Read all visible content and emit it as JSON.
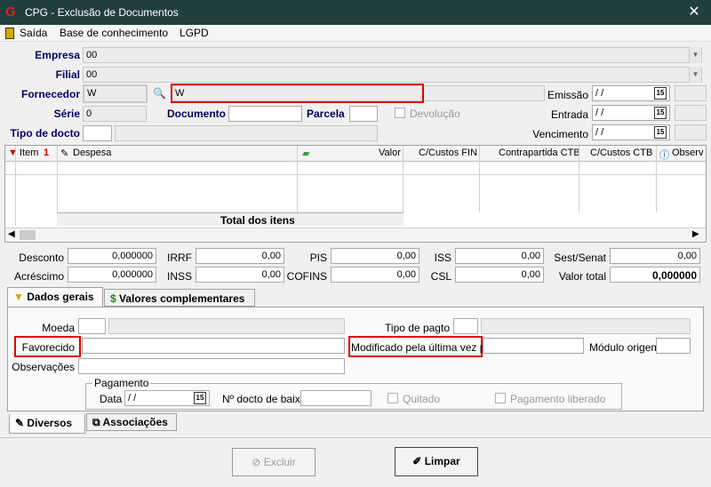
{
  "window": {
    "title": "CPG - Exclusão de Documentos",
    "close": "✕"
  },
  "menu": {
    "saida": "Saída",
    "base": "Base de conhecimento",
    "lgpd": "LGPD"
  },
  "header": {
    "empresa_label": "Empresa",
    "empresa_value": "00",
    "filial_label": "Filial",
    "filial_value": "00",
    "fornecedor_label": "Fornecedor",
    "fornecedor_code": "W",
    "fornecedor_name": "W",
    "emissao_label": "Emissão",
    "emissao_value": "/  /",
    "serie_label": "Série",
    "serie_value": "0",
    "documento_label": "Documento",
    "documento_value": "",
    "parcela_label": "Parcela",
    "parcela_value": "",
    "devolucao_label": "Devolução",
    "entrada_label": "Entrada",
    "entrada_value": "/  /",
    "tipo_docto_label": "Tipo de docto",
    "vencimento_label": "Vencimento",
    "vencimento_value": "/  /",
    "cal_glyph": "15"
  },
  "grid": {
    "columns": {
      "item": "Item",
      "despesa": "Despesa",
      "valor": "Valor",
      "custos_fin": "C/Custos FIN",
      "contrapartida": "Contrapartida CTB",
      "custos_ctb": "C/Custos CTB",
      "obs": "Observ"
    },
    "total_label": "Total dos itens"
  },
  "totals": {
    "desconto_label": "Desconto",
    "desconto": "0,000000",
    "irrf_label": "IRRF",
    "irrf": "0,00",
    "pis_label": "PIS",
    "pis": "0,00",
    "iss_label": "ISS",
    "iss": "0,00",
    "sest_label": "Sest/Senat",
    "sest": "0,00",
    "acrescimo_label": "Acréscimo",
    "acrescimo": "0,000000",
    "inss_label": "INSS",
    "inss": "0,00",
    "cofins_label": "COFINS",
    "cofins": "0,00",
    "csl_label": "CSL",
    "csl": "0,00",
    "valor_total_label": "Valor total",
    "valor_total": "0,000000"
  },
  "tabs": {
    "dados_gerais": "Dados gerais",
    "valores_complementares": "Valores complementares",
    "diversos": "Diversos",
    "associacoes": "Associações"
  },
  "general": {
    "moeda_label": "Moeda",
    "tipo_pagto_label": "Tipo de pagto",
    "favorecido_label": "Favorecido",
    "modificado_label": "Modificado pela última vez por",
    "modulo_label": "Módulo origem",
    "observacoes_label": "Observações",
    "pagamento_label": "Pagamento",
    "data_label": "Data",
    "data_value": "/  /",
    "ndocto_label": "Nº docto de baixa",
    "quitado_label": "Quitado",
    "pag_liberado_label": "Pagamento liberado"
  },
  "buttons": {
    "excluir": "Excluir",
    "limpar": "Limpar"
  },
  "colors": {
    "titlebar": "#223f3f",
    "highlight": "#e00000",
    "label_blue": "#000060"
  }
}
